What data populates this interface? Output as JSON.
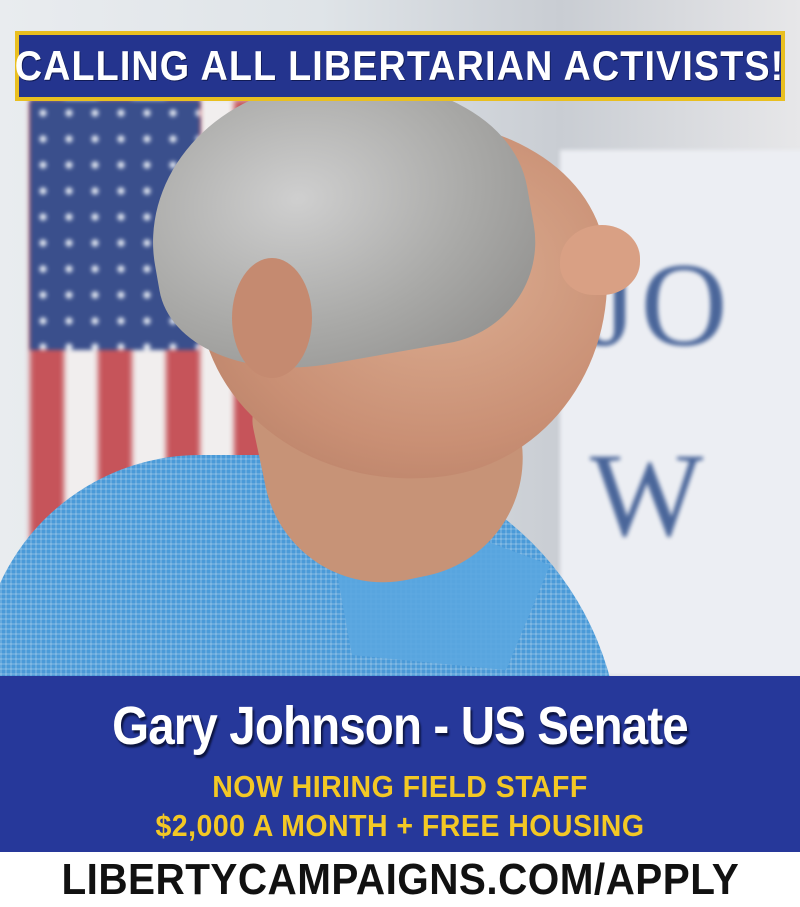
{
  "banner": {
    "top_text": "CALLING ALL LIBERTARIAN ACTIVISTS!"
  },
  "photo": {
    "sign_text": "JO\nW"
  },
  "panel": {
    "headline": "Gary Johnson - US Senate",
    "line1": "NOW HIRING FIELD STAFF",
    "line2": "$2,000 A MONTH + FREE HOUSING"
  },
  "footer": {
    "url": "LIBERTYCAMPAIGNS.COM/APPLY"
  },
  "colors": {
    "banner_blue": "#24348e",
    "banner_border_gold": "#e9bf20",
    "panel_blue": "#26389a",
    "accent_yellow": "#f3c825",
    "headline_white": "#ffffff",
    "footer_text": "#111111"
  }
}
